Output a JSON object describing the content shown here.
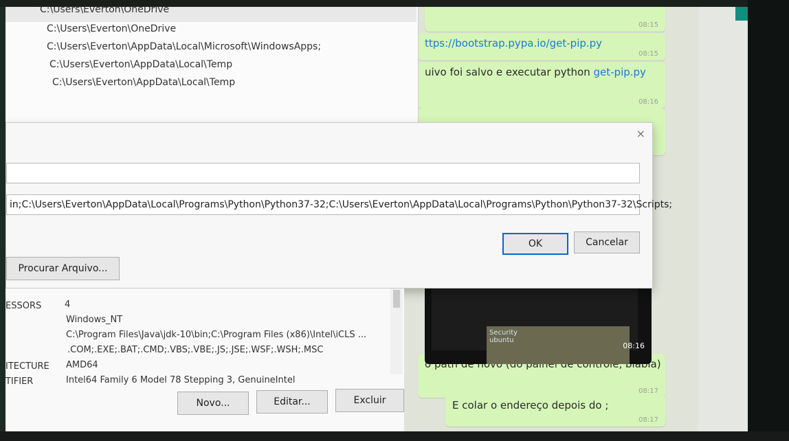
{
  "env_window": {
    "rows": [
      "C:\\Users\\Everton\\OneDrive",
      "C:\\Users\\Everton\\OneDrive",
      "C:\\Users\\Everton\\AppData\\Local\\Microsoft\\WindowsApps;",
      "C:\\Users\\Everton\\AppData\\Local\\Temp",
      "C:\\Users\\Everton\\AppData\\Local\\Temp"
    ]
  },
  "dialog": {
    "close": "×",
    "path_value": "in;C:\\Users\\Everton\\AppData\\Local\\Programs\\Python\\Python37-32;C:\\Users\\Everton\\AppData\\Local\\Programs\\Python\\Python37-32\\Scripts;",
    "ok": "OK",
    "cancel": "Cancelar",
    "browse": "Procurar Arquivo..."
  },
  "system_vars": {
    "rows": [
      {
        "name": "ESSORS",
        "value": "4"
      },
      {
        "name": "",
        "value": "Windows_NT"
      },
      {
        "name": "",
        "value": "C:\\Program Files\\Java\\jdk-10\\bin;C:\\Program Files (x86)\\Intel\\iCLS ..."
      },
      {
        "name": "",
        "value": ".COM;.EXE;.BAT;.CMD;.VBS;.VBE;.JS;.JSE;.WSF;.WSH;.MSC"
      },
      {
        "name": "ITECTURE",
        "value": "AMD64"
      },
      {
        "name": "TIFIER",
        "value": "Intel64 Family 6 Model 78 Stepping 3, GenuineIntel"
      }
    ],
    "buttons": {
      "new": "Novo...",
      "edit": "Editar...",
      "delete": "Excluir"
    }
  },
  "chat": {
    "messages": [
      {
        "text": "",
        "time": "08:15"
      },
      {
        "text": "ttps://bootstrap.pypa.io/get-pip.py",
        "time": "08:15"
      },
      {
        "text": "uivo foi salvo e executar python ",
        "link": "get-pip.py",
        "time": "08:16"
      },
      {
        "text": "o path de novo (do painel de controle, blabla)",
        "time": "08:17"
      },
      {
        "text": "E colar o endereço depois do ;",
        "time": "08:17"
      }
    ],
    "media": {
      "time": "08:16",
      "screen_word": "Security",
      "screen_word2": "ubuntu"
    }
  },
  "colors": {
    "bubble": "#d6f5b8",
    "link": "#1a7bd1",
    "ok_border": "#0a64c8",
    "whatsapp_teal": "#0f8f7e"
  }
}
